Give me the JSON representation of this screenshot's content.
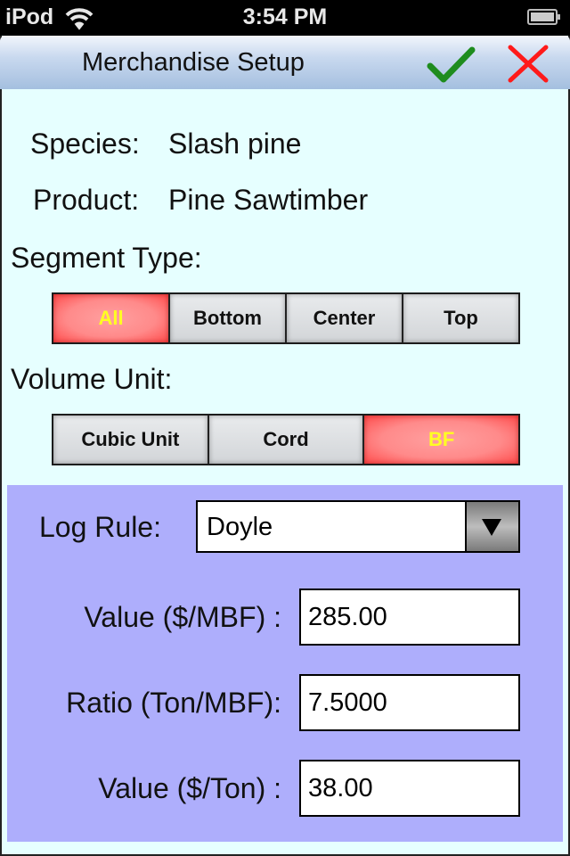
{
  "status_bar": {
    "carrier": "iPod",
    "time": "3:54 PM",
    "wifi_icon": "wifi-icon",
    "battery_icon": "battery-full-icon"
  },
  "navbar": {
    "title": "Merchandise Setup",
    "ok_icon": "checkmark-icon",
    "cancel_icon": "close-icon",
    "colors": {
      "ok": "#1e8c1e",
      "cancel": "#ff1a1a"
    }
  },
  "info": {
    "species_label": "Species:",
    "species_value": "Slash pine",
    "product_label": "Product:",
    "product_value": "Pine Sawtimber"
  },
  "segment_type": {
    "label": "Segment Type:",
    "options": [
      "All",
      "Bottom",
      "Center",
      "Top"
    ],
    "selected": "All"
  },
  "volume_unit": {
    "label": "Volume Unit:",
    "options": [
      "Cubic Unit",
      "Cord",
      "BF"
    ],
    "selected": "BF"
  },
  "bf_panel": {
    "log_rule_label": "Log Rule:",
    "log_rule_value": "Doyle",
    "dropdown_icon": "triangle-down-icon",
    "value_mbf_label": "Value ($/MBF) :",
    "value_mbf": "285.00",
    "ratio_label": "Ratio (Ton/MBF):",
    "ratio": "7.5000",
    "value_ton_label": "Value ($/Ton) :",
    "value_ton": "38.00"
  },
  "colors": {
    "background": "#e6ffff",
    "panel": "#aeaefc",
    "selected_segment": "#ff6b6b",
    "selected_segment_text": "#ffff22"
  }
}
